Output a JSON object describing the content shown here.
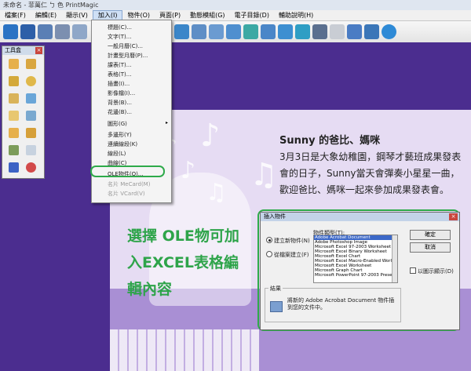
{
  "window": {
    "title": "未命名 - 菲萬仁 ㄅ 色 PrintMagic"
  },
  "menubar": [
    "檔案(F)",
    "編輯(E)",
    "顯示(V)",
    "加入(I)",
    "物件(O)",
    "頁面(P)",
    "動態模組(G)",
    "電子目錄(D)",
    "輔助說明(H)"
  ],
  "toolbox": {
    "title": "工具盒",
    "close": "×"
  },
  "insert_menu": {
    "items": [
      {
        "label": "標題(C)..."
      },
      {
        "label": "文字(T)..."
      },
      {
        "label": "一般月曆(C)..."
      },
      {
        "label": "計畫型月曆(P)..."
      },
      {
        "label": "課表(T)..."
      },
      {
        "label": "表格(T)..."
      },
      {
        "label": "插畫(I)..."
      },
      {
        "label": "影像檔(I)..."
      },
      {
        "label": "背景(B)..."
      },
      {
        "label": "花邊(B)..."
      },
      {
        "label": "圖形(G)"
      },
      {
        "label": "多邊形(Y)"
      },
      {
        "label": "連續線段(K)"
      },
      {
        "label": "線段(L)"
      },
      {
        "label": "曲線(C)"
      },
      {
        "label": "OLE物件(O)..."
      },
      {
        "label": "名片 MeCard(M)"
      },
      {
        "label": "名片 VCard(V)"
      }
    ],
    "submenu_arrow": "▸"
  },
  "document": {
    "headline": "Sunny 的爸比、媽咪",
    "body": "3月3日是大象幼稚園，鋼琴才藝班成果發表會的日子，Sunny當天會彈奏小星星一曲，歡迎爸比、媽咪一起來參加成果發表會。",
    "notes": [
      "♪",
      "♫",
      "♪",
      "♫",
      "♪"
    ]
  },
  "annotation": "選擇 OLE物可加入EXCEL表格編輯內容",
  "dialog": {
    "title": "插入物件",
    "close": "×",
    "object_type_label": "物件類型(T):",
    "radio_new": "建立新物件(N)",
    "radio_file": "從檔案建立(F)",
    "object_types": [
      "Adobe Acrobat Document",
      "Adobe Photoshop Image",
      "Microsoft Excel 97-2003 Worksheet",
      "Microsoft Excel Binary Worksheet",
      "Microsoft Excel Chart",
      "Microsoft Excel Macro-Enabled Worl",
      "Microsoft Excel Worksheet",
      "Microsoft Graph Chart",
      "Microsoft PowerPoint 97-2003 Presen"
    ],
    "ok": "確定",
    "cancel": "取消",
    "display_as_icon": "以圖示顯示(D)",
    "result_label": "結果",
    "result_text": "將新的 Adobe Acrobat Document 物件插到您的文件中。"
  }
}
